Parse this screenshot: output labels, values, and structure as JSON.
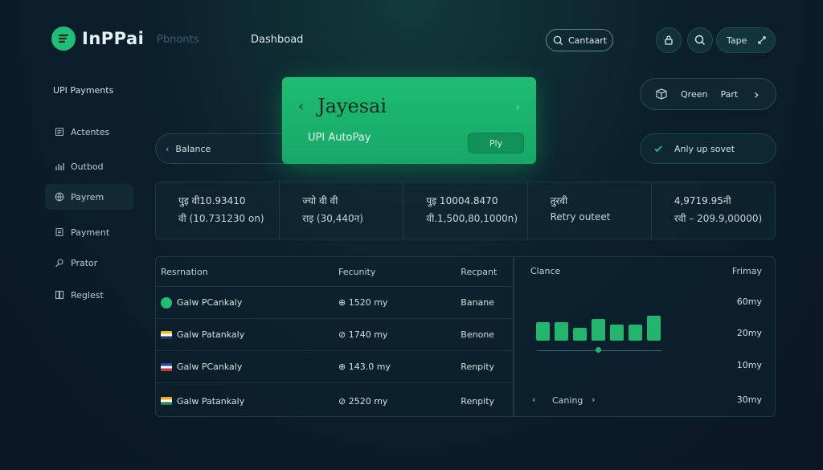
{
  "app": {
    "logo_text": "InPPai"
  },
  "header": {
    "nav_faded": "Pbnonts",
    "nav_active": "Dashboad",
    "search_label": "Cantaart",
    "tape_label": "Tape"
  },
  "sidebar": {
    "heading": "UPI Payments",
    "items": [
      {
        "label": "Actentes",
        "icon": "list-icon"
      },
      {
        "label": "Outbod",
        "icon": "bar-chart-icon"
      },
      {
        "label": "Payrem",
        "icon": "globe-icon"
      },
      {
        "label": "Payment",
        "icon": "document-icon"
      },
      {
        "label": "Prator",
        "icon": "pin-icon"
      },
      {
        "label": "Reglest",
        "icon": "book-icon"
      }
    ]
  },
  "balance": {
    "label": "Balance"
  },
  "card": {
    "name": "Jayesai",
    "subtitle": "UPI AutoPay",
    "button": "Ply"
  },
  "queue_pill": {
    "label": "Qreen",
    "action": "Part"
  },
  "status_pill": {
    "label": "Anly up sovet"
  },
  "stats": [
    {
      "l1": "पुइ वी10.93410",
      "l2": "वी (10.731230 on)"
    },
    {
      "l1": "ज्यो वी वी",
      "l2": "राइ (30,440न)"
    },
    {
      "l1": "पुइ 10004.8470",
      "l2": "वी.1,500,80,1000n)"
    },
    {
      "l1": "तुरवी",
      "l2": "Retry outeet"
    },
    {
      "l1": "4,9719.95नी",
      "l2": "रवी – 209.9,00000)"
    }
  ],
  "table": {
    "headers": [
      "Resrnation",
      "Fecunity",
      "Recpant"
    ],
    "rows": [
      {
        "name": "Galw PCankaly",
        "amount": "⊕ 1520 my",
        "status": "Banane"
      },
      {
        "name": "Galw Patankaly",
        "amount": "⊘ 1740 my",
        "status": "Benone"
      },
      {
        "name": "Galw PCankaly",
        "amount": "⊕ 143.0 my",
        "status": "Renpity"
      },
      {
        "name": "Galw Patankaly",
        "amount": "⊘ 2520 my",
        "status": "Renpity"
      }
    ]
  },
  "chart_panel": {
    "label": "Clance",
    "right_label": "Frimay",
    "values_text": [
      "60my",
      "20my",
      "10my",
      "30my"
    ],
    "footer_label": "Caning",
    "bars": [
      0.65,
      0.65,
      0.45,
      0.75,
      0.55,
      0.55,
      0.85
    ]
  }
}
